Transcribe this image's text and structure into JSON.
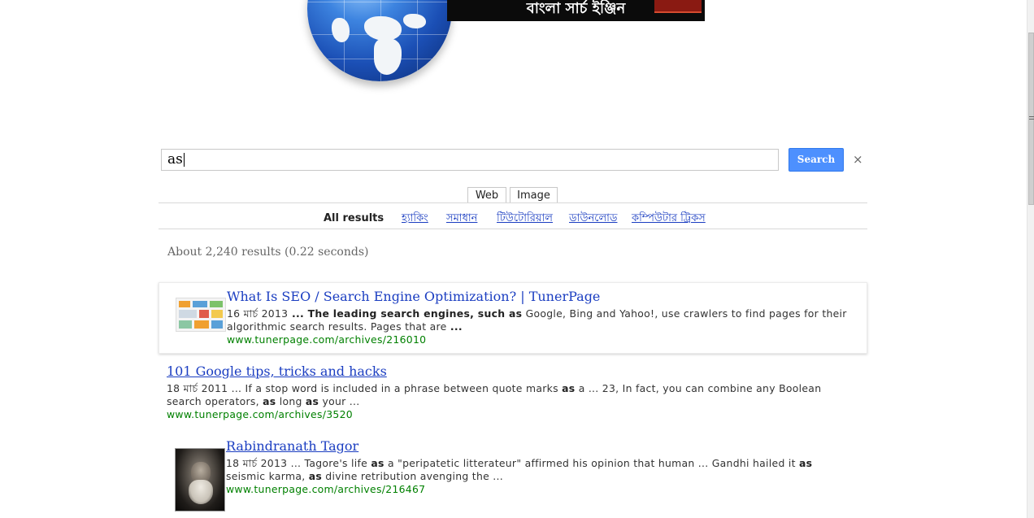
{
  "banner": {
    "text": "বাংলা সার্চ ইঞ্জিন",
    "icon": "globe-icon"
  },
  "search": {
    "value": "as",
    "button_label": "Search",
    "clear_label": "×",
    "button_color": "#4d90fe"
  },
  "tabs": [
    {
      "label": "Web"
    },
    {
      "label": "Image"
    }
  ],
  "refinements": {
    "active": "All results",
    "links": [
      "হ্যাকিং",
      "সমাধান",
      "টিউটোরিয়াল",
      "ডাউনলোড",
      "কম্পিউটার ট্রিকস"
    ]
  },
  "results_info": "About 2,240 results (0.22 seconds)",
  "results": [
    {
      "title": "What Is SEO / Search Engine Optimization? | TunerPage",
      "date": "16 মার্চ 2013",
      "snippet_line1": " ... The leading search engines, such ",
      "snippet_bold1": "as",
      "snippet_line1b": " Google, Bing and Yahoo!, use crawlers to find pages for their",
      "snippet_line2": "algorithmic search results. Pages that are ",
      "snippet_tail": "...",
      "url": "www.tunerpage.com/archives/216010",
      "thumbnail": "seo-infographic-thumbnail"
    },
    {
      "title": "101 Google tips, tricks and hacks",
      "date": "18 মার্চ 2011",
      "snippet_line1": " ... If a stop word is included in a phrase between quote marks ",
      "snippet_bold1": "as",
      "snippet_line1b": " a ... 23, In fact, you can combine any Boolean",
      "snippet_line2a": "search operators, ",
      "snippet_bold2": "as",
      "snippet_line2b": " long ",
      "snippet_bold3": "as",
      "snippet_line2c": " your ...",
      "url": "www.tunerpage.com/archives/3520"
    },
    {
      "title": "Rabindranath Tagor",
      "date": "18 মার্চ 2013",
      "snippet_line1": " ... Tagore's life ",
      "snippet_bold1": "as",
      "snippet_line1b": " a \"peripatetic litterateur\" affirmed his opinion that human ... Gandhi hailed it ",
      "snippet_bold_end": "as",
      "snippet_line2a": "seismic karma, ",
      "snippet_bold2": "as",
      "snippet_line2b": " divine retribution avenging the ...",
      "url": "www.tunerpage.com/archives/216467",
      "thumbnail": "portrait-thumbnail"
    }
  ]
}
